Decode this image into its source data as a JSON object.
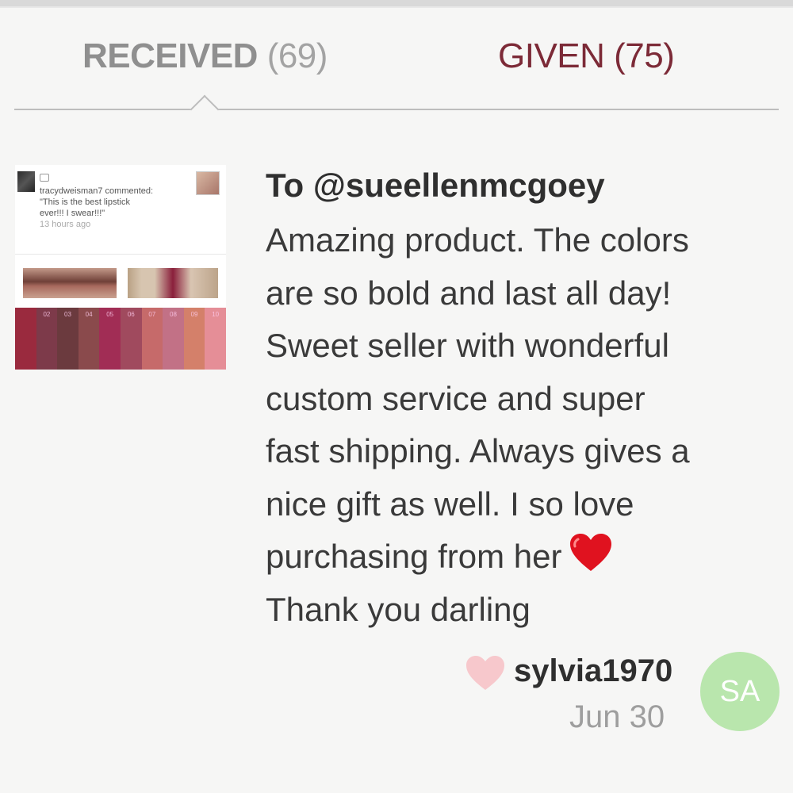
{
  "tabs": {
    "received": {
      "label": "RECEIVED",
      "count": "(69)"
    },
    "given": {
      "label": "GIVEN",
      "count": "(75)"
    },
    "active": "received"
  },
  "thumbnail": {
    "comment_lines": [
      "tracydweisman7 commented:",
      "\"This is the best lipstick",
      "ever!!! I swear!!!\""
    ],
    "comment_time": "13 hours ago",
    "swatch_labels": [
      "",
      "02",
      "03",
      "04",
      "05",
      "06",
      "07",
      "08",
      "09",
      "10"
    ],
    "swatch_colors": [
      "#9a2a3e",
      "#7d3a4a",
      "#6b3a3e",
      "#8a4a4c",
      "#a12d55",
      "#a04a5e",
      "#c66a6a",
      "#c27186",
      "#d4806a",
      "#e58e97"
    ]
  },
  "review": {
    "to": "To @sueellenmcgoey",
    "lines": [
      "Amazing product. The colors",
      "are so bold and last all day!",
      "Sweet seller with wonderful",
      "custom service and super",
      "fast shipping. Always gives a",
      "nice gift as well. I so love",
      "purchasing from her",
      "Thank you darling"
    ],
    "heart_emoji_icon": "red-heart-icon"
  },
  "reviewer": {
    "username": "sylvia1970",
    "date": "Jun 30",
    "initials": "SA",
    "avatar_color": "#b9e6ad"
  },
  "colors": {
    "given_tab": "#7c2a37",
    "received_tab": "#9b9b9b",
    "like_heart": "#f7c8cc"
  }
}
